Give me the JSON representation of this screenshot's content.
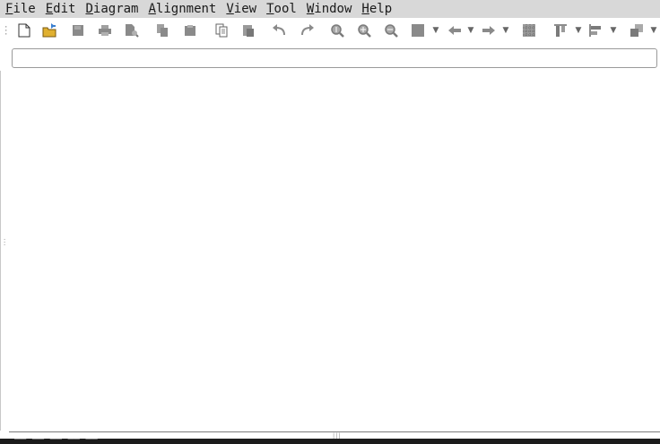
{
  "menu": {
    "items": [
      {
        "mnemonic": "F",
        "rest": "ile"
      },
      {
        "mnemonic": "E",
        "rest": "dit"
      },
      {
        "mnemonic": "D",
        "rest": "iagram"
      },
      {
        "mnemonic": "A",
        "rest": "lignment"
      },
      {
        "mnemonic": "V",
        "rest": "iew"
      },
      {
        "mnemonic": "T",
        "rest": "ool"
      },
      {
        "mnemonic": "W",
        "rest": "indow"
      },
      {
        "mnemonic": "H",
        "rest": "elp"
      }
    ]
  },
  "toolbar": {
    "buttons": [
      "new-document-icon",
      "open-folder-icon",
      "save-icon",
      "print-icon",
      "print-preview-icon",
      "copy-icon",
      "paste-icon",
      "copy-page-icon",
      "paste-page-icon",
      "undo-icon",
      "redo-icon",
      "zoom-actual-icon",
      "zoom-in-icon",
      "zoom-out-icon",
      "fill-color-icon",
      "arrow-back-icon",
      "arrow-forward-icon",
      "grid-icon",
      "align-top-icon",
      "align-left-icon",
      "layers-icon"
    ]
  },
  "search": {
    "value": "",
    "placeholder": ""
  },
  "colors": {
    "menubar_bg": "#d8d8d8",
    "icon_gray": "#8a8a8a",
    "open_folder_blue": "#3a7fd0",
    "open_folder_yellow": "#e0b030",
    "status_bg": "#1b1b1b"
  },
  "status": {
    "text": "—— —— —— —— ——"
  }
}
